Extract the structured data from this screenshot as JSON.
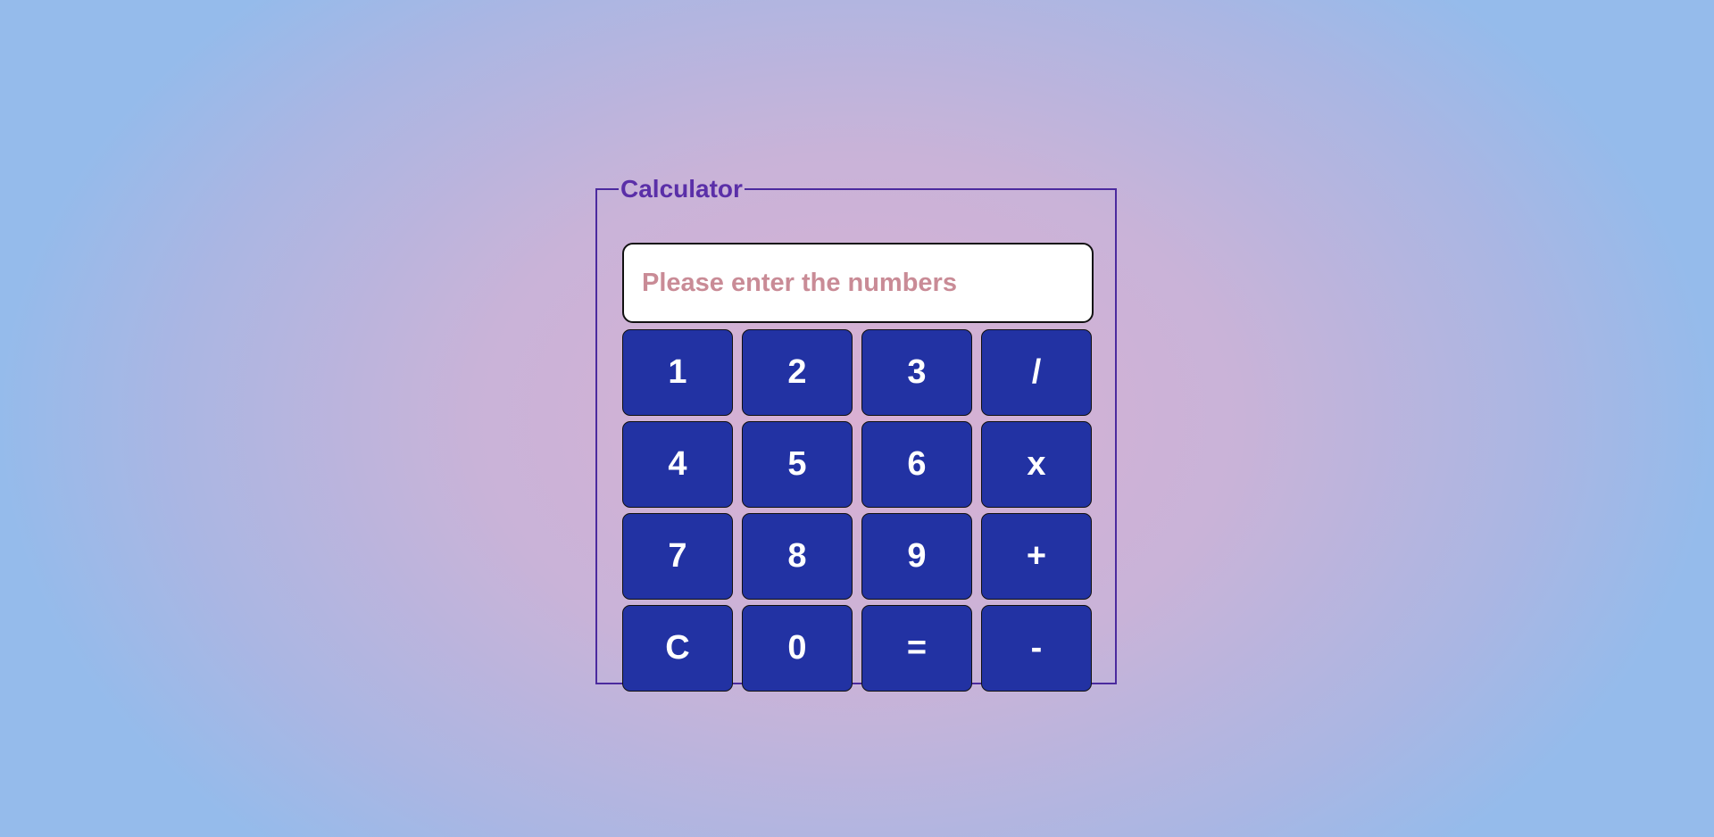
{
  "calculator": {
    "legend": "Calculator",
    "display": {
      "value": "",
      "placeholder": "Please enter the numbers"
    },
    "keys": [
      "1",
      "2",
      "3",
      "/",
      "4",
      "5",
      "6",
      "x",
      "7",
      "8",
      "9",
      "+",
      "C",
      "0",
      "=",
      "-"
    ]
  },
  "colors": {
    "legend": "#5a2fa8",
    "fieldset_border": "#4b2a9e",
    "key_background": "#2232a3",
    "key_text": "#ffffff",
    "placeholder": "#c98b96",
    "background_center": "#d9b0d3",
    "background_edge": "#95bbeb"
  }
}
